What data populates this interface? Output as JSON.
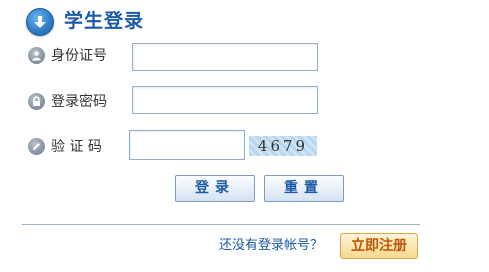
{
  "header": {
    "title": "学生登录",
    "icon": "download-circle-icon"
  },
  "form": {
    "id_number": {
      "label": "身份证号",
      "value": "",
      "icon": "user-icon"
    },
    "password": {
      "label": "登录密码",
      "value": "",
      "icon": "lock-icon"
    },
    "captcha": {
      "label": "验 证 码",
      "value": "",
      "code": "4679",
      "icon": "pencil-icon"
    }
  },
  "buttons": {
    "login": "登录",
    "reset": "重置"
  },
  "signup": {
    "prompt": "还没有登录帐号？",
    "button": "立即注册"
  },
  "colors": {
    "accent": "#1b5aa6",
    "signup_text": "#c0550a"
  }
}
